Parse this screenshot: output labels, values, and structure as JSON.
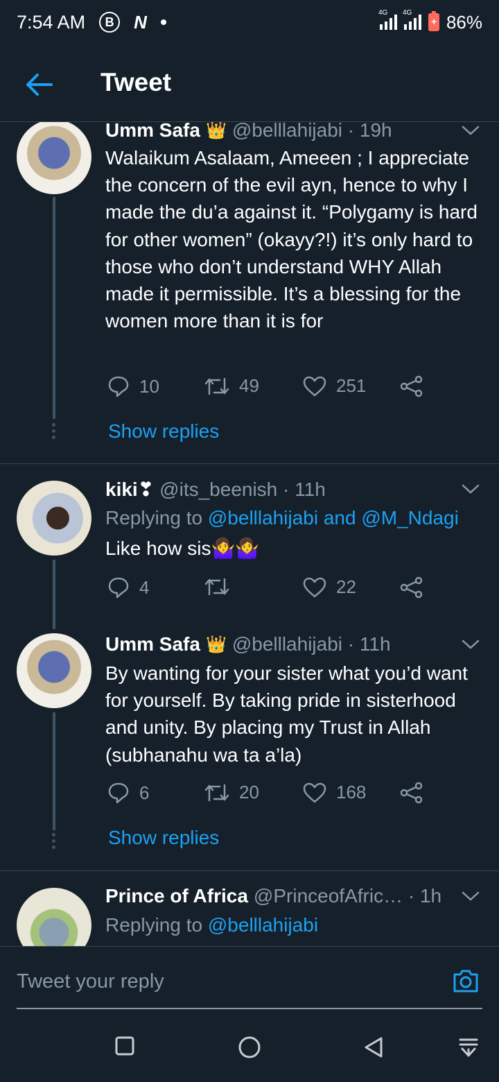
{
  "status_bar": {
    "time": "7:54 AM",
    "badge_b": "B",
    "badge_n": "N",
    "network_1": "4G",
    "network_2": "4G",
    "battery_percent": "86%"
  },
  "header": {
    "title": "Tweet"
  },
  "tweets": [
    {
      "name": "Umm Safa",
      "crown": "👑",
      "handle": "@belllahijabi · 19h",
      "body": "Walaikum Asalaam, Ameeen ; I appreciate the concern of the evil ayn, hence to why I made the du’a against it. “Polygamy is hard for other women” (okayy?!) it’s only hard to those who don’t understand WHY Allah made it permissible. It’s a blessing for the women more than it is for",
      "replies": "10",
      "retweets": "49",
      "likes": "251",
      "show_replies": "Show replies"
    },
    {
      "name": "kiki❣",
      "handle": "@its_beenish · 11h",
      "replying_to_prefix": "Replying to ",
      "replying_to_links": "@belllahijabi and @M_Ndagi",
      "body": "Like how sis🤷‍♀️🤷‍♀️",
      "replies": "4",
      "retweets": "",
      "likes": "22"
    },
    {
      "name": "Umm Safa",
      "crown": "👑",
      "handle": "@belllahijabi · 11h",
      "body": "By wanting for your sister what you’d want for yourself. By taking pride in sisterhood and unity. By placing my Trust in Allah (subhanahu wa ta a’la)",
      "replies": "6",
      "retweets": "20",
      "likes": "168",
      "show_replies": "Show replies"
    },
    {
      "name": "Prince of Africa",
      "handle": "@PrinceofAfric… · 1h",
      "replying_to_prefix": "Replying to ",
      "replying_to_links": "@belllahijabi"
    }
  ],
  "reply_bar": {
    "placeholder": "Tweet your reply"
  },
  "colors": {
    "background": "#15202b",
    "accent": "#1da1f2",
    "secondary_text": "#8899a6",
    "divider": "#38444d"
  }
}
